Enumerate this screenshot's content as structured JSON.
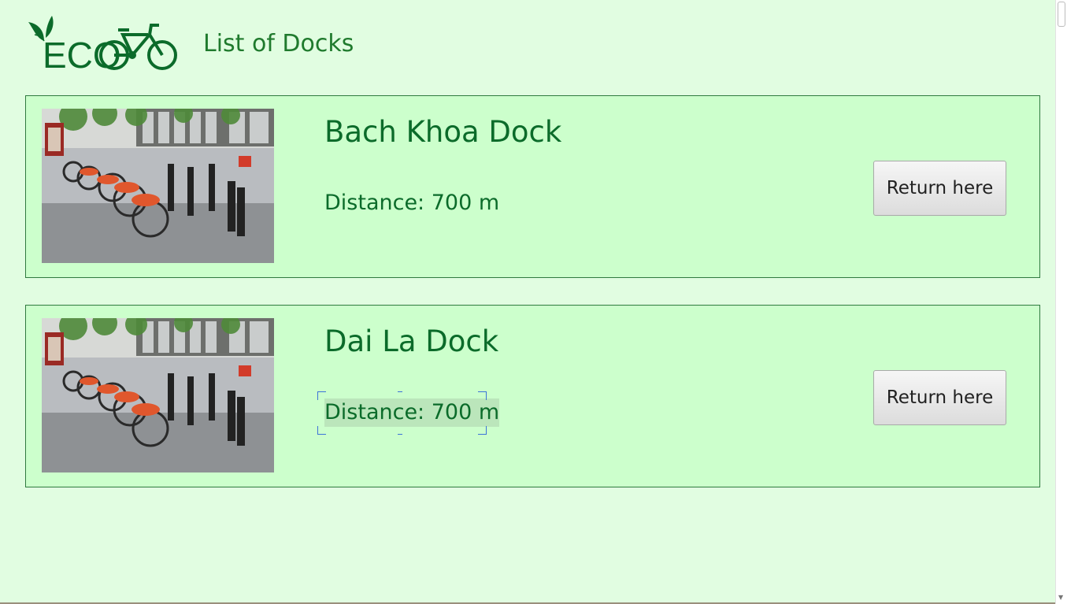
{
  "header": {
    "logo_text": "ECO",
    "title": "List of Docks"
  },
  "docks": [
    {
      "name": "Bach Khoa Dock",
      "distance": "Distance: 700 m",
      "button_label": "Return here"
    },
    {
      "name": "Dai La Dock",
      "distance": "Distance: 700 m",
      "button_label": "Return here"
    }
  ],
  "colors": {
    "background": "#e1fde1",
    "card": "#ccffcc",
    "brand_green": "#0b6b2a"
  },
  "icons": {
    "logo": "eco-bicycle-leaf-logo",
    "photo": "bike-dock-photo"
  }
}
